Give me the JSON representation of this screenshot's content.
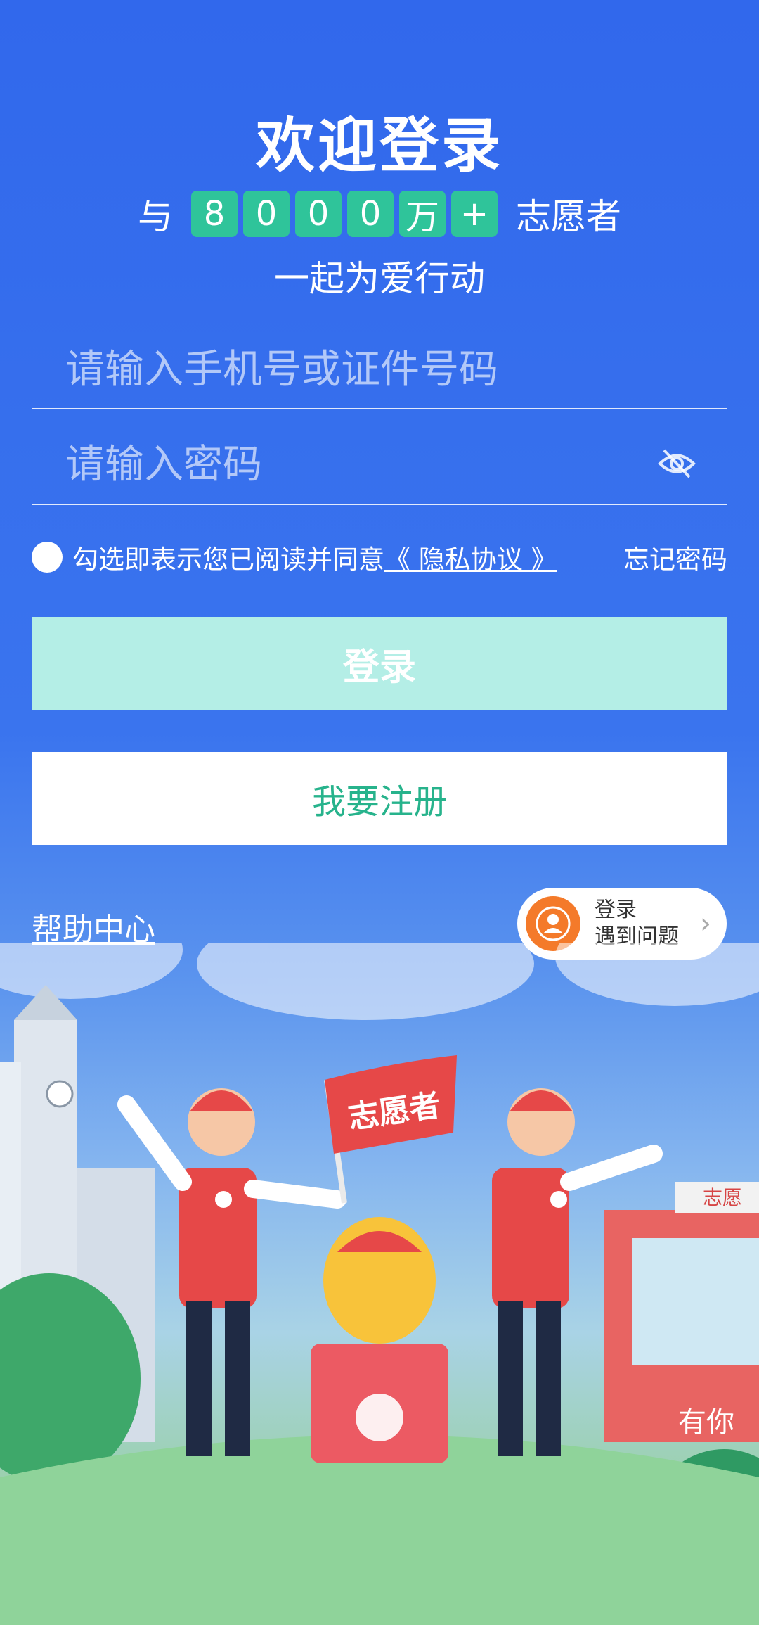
{
  "header": {
    "title": "欢迎登录",
    "counter_prefix": "与",
    "counter_digits": [
      "8",
      "0",
      "0",
      "0",
      "万",
      "+"
    ],
    "counter_suffix": "志愿者",
    "subtitle": "一起为爱行动"
  },
  "form": {
    "account_placeholder": "请输入手机号或证件号码",
    "password_placeholder": "请输入密码",
    "password_toggle_icon": "eye-hidden-icon",
    "agreement_text": "勾选即表示您已阅读并同意",
    "agreement_link": "《 隐私协议 》",
    "forgot_password": "忘记密码",
    "login_button": "登录",
    "register_button": "我要注册"
  },
  "footer": {
    "help_center": "帮助中心",
    "issue_line1": "登录",
    "issue_line2": "遇到问题"
  },
  "illustration": {
    "flag_text": "志愿者",
    "booth_sign": "志愿",
    "booth_bottom": "有你"
  },
  "colors": {
    "background": "#3370ee",
    "accent_green": "#2fc49a",
    "login_button_bg": "#b4eee6",
    "register_text": "#27b38c",
    "orange": "#f47a2a",
    "vest_red": "#e64848"
  }
}
